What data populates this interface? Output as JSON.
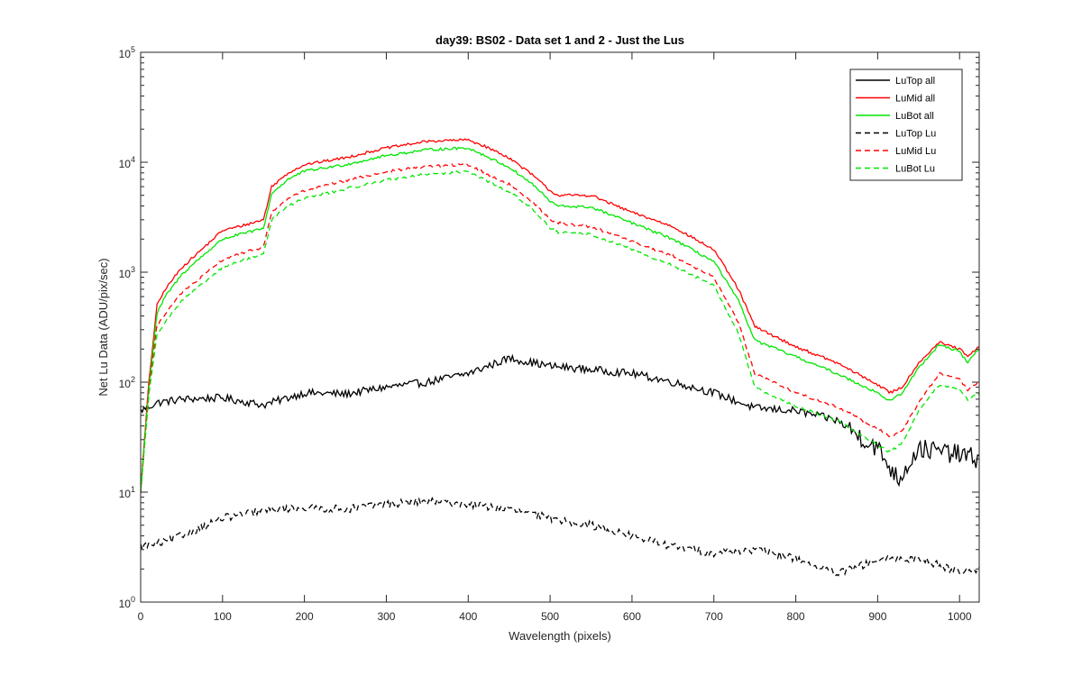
{
  "chart_data": {
    "type": "line",
    "title": "day39: BS02 - Data set 1 and 2 - Just the Lus",
    "xlabel": "Wavelength (pixels)",
    "ylabel": "Net Lu Data (ADU/pix/sec)",
    "xlim": [
      0,
      1024
    ],
    "ylim": [
      1,
      100000
    ],
    "yscale": "log",
    "x_ticks": [
      "0",
      "100",
      "200",
      "300",
      "400",
      "500",
      "600",
      "700",
      "800",
      "900",
      "1000"
    ],
    "y_ticks": [
      {
        "base": "10",
        "exp": "0"
      },
      {
        "base": "10",
        "exp": "1"
      },
      {
        "base": "10",
        "exp": "2"
      },
      {
        "base": "10",
        "exp": "3"
      },
      {
        "base": "10",
        "exp": "4"
      },
      {
        "base": "10",
        "exp": "5"
      }
    ],
    "grid": false,
    "legend_position": "top-right",
    "series": [
      {
        "name": "LuTop  all",
        "color": "#000000",
        "dash": "solid",
        "x": [
          0,
          20,
          50,
          100,
          150,
          200,
          250,
          300,
          350,
          400,
          450,
          500,
          550,
          600,
          650,
          700,
          750,
          800,
          850,
          900,
          925,
          950,
          1000,
          1024
        ],
        "y": [
          55,
          65,
          70,
          72,
          62,
          80,
          78,
          90,
          100,
          120,
          165,
          140,
          130,
          120,
          100,
          80,
          58,
          55,
          45,
          25,
          13,
          25,
          22,
          20
        ]
      },
      {
        "name": "LuMid  all",
        "color": "#ff0000",
        "dash": "solid",
        "x": [
          0,
          10,
          20,
          30,
          50,
          70,
          100,
          120,
          150,
          160,
          180,
          200,
          250,
          300,
          350,
          400,
          420,
          450,
          480,
          500,
          510,
          550,
          600,
          650,
          700,
          730,
          750,
          800,
          850,
          900,
          915,
          930,
          950,
          975,
          1000,
          1010,
          1024
        ],
        "y": [
          10,
          100,
          500,
          700,
          1100,
          1500,
          2400,
          2600,
          3000,
          6000,
          8000,
          9500,
          11000,
          13500,
          15500,
          16000,
          14000,
          11000,
          7500,
          5500,
          5000,
          5000,
          3500,
          2600,
          1600,
          700,
          320,
          210,
          150,
          95,
          80,
          90,
          150,
          230,
          200,
          170,
          210
        ]
      },
      {
        "name": "LuBot  all",
        "color": "#00e600",
        "dash": "solid",
        "x": [
          0,
          10,
          20,
          30,
          50,
          70,
          100,
          120,
          150,
          160,
          180,
          200,
          250,
          300,
          350,
          400,
          420,
          450,
          480,
          500,
          510,
          550,
          600,
          650,
          700,
          730,
          750,
          800,
          850,
          900,
          915,
          930,
          950,
          975,
          1000,
          1010,
          1024
        ],
        "y": [
          10,
          90,
          420,
          600,
          950,
          1300,
          2000,
          2200,
          2500,
          5200,
          7000,
          8300,
          9500,
          11500,
          13000,
          13500,
          11500,
          9000,
          6200,
          4400,
          4000,
          3900,
          2800,
          2000,
          1250,
          550,
          240,
          170,
          120,
          80,
          67,
          80,
          135,
          220,
          190,
          150,
          205
        ]
      },
      {
        "name": "LuTop  Lu",
        "color": "#000000",
        "dash": "dashed",
        "x": [
          0,
          30,
          60,
          100,
          150,
          200,
          250,
          300,
          350,
          400,
          450,
          500,
          550,
          600,
          650,
          700,
          750,
          800,
          850,
          900,
          950,
          1000,
          1024
        ],
        "y": [
          3.2,
          3.5,
          4.3,
          5.8,
          6.8,
          7.2,
          7.0,
          7.8,
          8.2,
          7.8,
          7.0,
          5.8,
          5.0,
          4.0,
          3.2,
          2.8,
          3.0,
          2.5,
          1.8,
          2.4,
          2.5,
          1.9,
          2.0
        ]
      },
      {
        "name": "LuMid  Lu",
        "color": "#ff0000",
        "dash": "dashed",
        "x": [
          0,
          10,
          20,
          30,
          50,
          70,
          100,
          120,
          150,
          160,
          180,
          200,
          250,
          300,
          350,
          400,
          420,
          450,
          480,
          500,
          510,
          550,
          600,
          650,
          700,
          730,
          750,
          800,
          850,
          900,
          915,
          930,
          950,
          975,
          1000,
          1010,
          1024
        ],
        "y": [
          10,
          85,
          330,
          420,
          650,
          850,
          1300,
          1450,
          1700,
          3500,
          4700,
          5500,
          6800,
          8200,
          9200,
          9500,
          8000,
          6300,
          4300,
          3000,
          2800,
          2600,
          1900,
          1400,
          900,
          350,
          120,
          80,
          60,
          38,
          32,
          36,
          65,
          120,
          105,
          85,
          100
        ]
      },
      {
        "name": "LuBot  Lu",
        "color": "#00e600",
        "dash": "dashed",
        "x": [
          0,
          10,
          20,
          30,
          50,
          70,
          100,
          120,
          150,
          160,
          180,
          200,
          250,
          300,
          350,
          400,
          420,
          450,
          480,
          500,
          510,
          550,
          600,
          650,
          700,
          730,
          750,
          800,
          850,
          900,
          915,
          930,
          950,
          975,
          1000,
          1010,
          1024
        ],
        "y": [
          10,
          75,
          280,
          350,
          550,
          720,
          1100,
          1250,
          1450,
          3000,
          4000,
          4700,
          5700,
          6900,
          7800,
          8200,
          6900,
          5400,
          3700,
          2500,
          2300,
          2200,
          1600,
          1150,
          750,
          280,
          90,
          60,
          45,
          27,
          23,
          28,
          55,
          95,
          85,
          70,
          80
        ]
      }
    ]
  }
}
